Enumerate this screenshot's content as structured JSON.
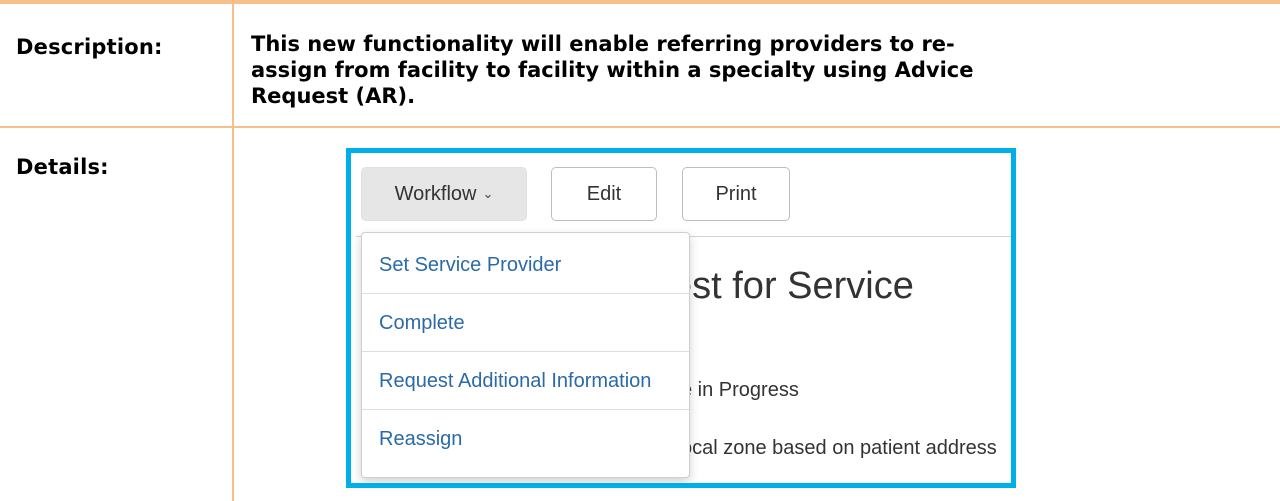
{
  "rows": {
    "description": {
      "label": "Description:",
      "text": "This new functionality will enable referring providers to re-assign from facility to facility within a specialty using Advice Request (AR)."
    },
    "details": {
      "label": "Details:"
    }
  },
  "screenshot": {
    "toolbar": {
      "workflow_label": "Workflow",
      "edit_label": "Edit",
      "print_label": "Print"
    },
    "workflow_menu": [
      "Set Service Provider",
      "Complete",
      "Request Additional Information",
      "Reassign"
    ],
    "heading_partial": "est for Service",
    "status_partial": "e in Progress",
    "zone_partial": "ocal zone based on patient address"
  },
  "colors": {
    "table_border": "#f5c08a",
    "panel_border": "#00aee8",
    "menu_link": "#2b6aa8"
  }
}
